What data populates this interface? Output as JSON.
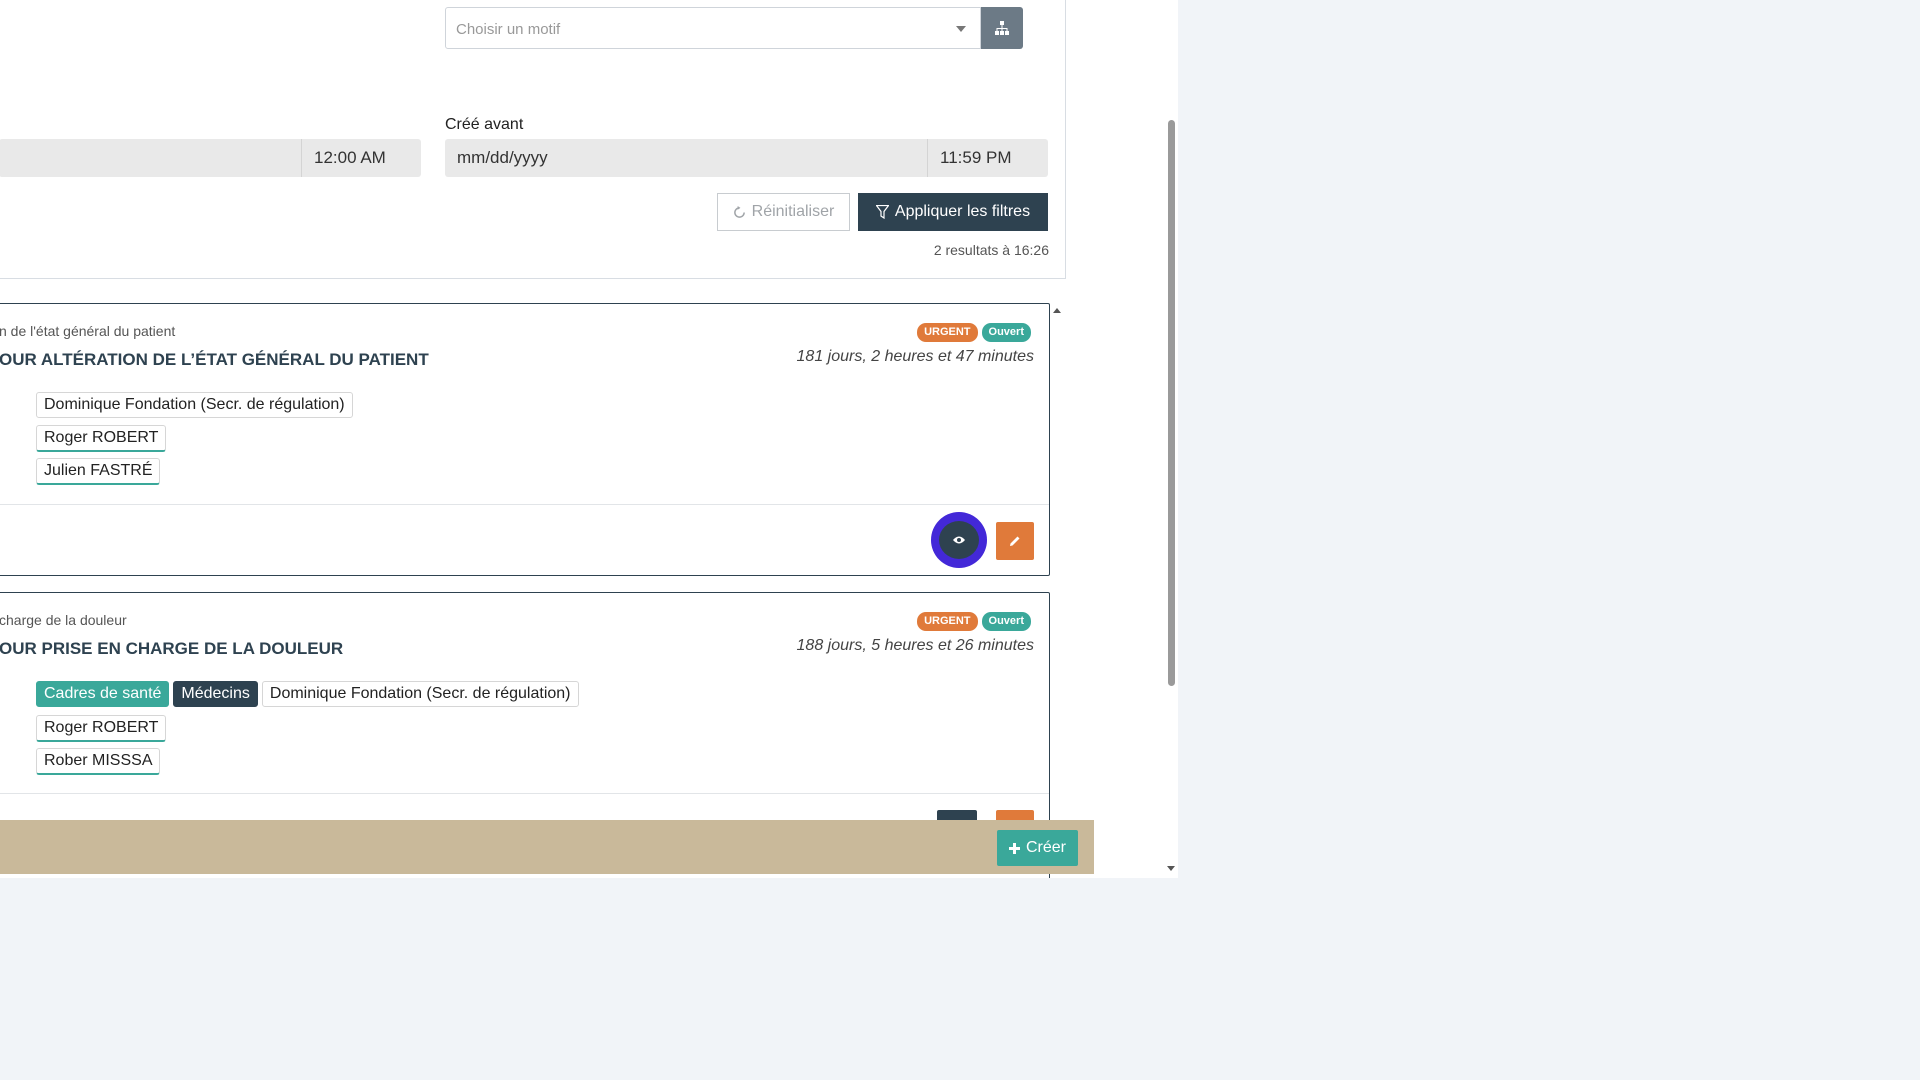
{
  "filters": {
    "motif_placeholder": "Choisir un motif",
    "created_after_time": "12:00 AM",
    "created_before_label": "Créé avant",
    "created_before_date_placeholder": "mm/dd/yyyy",
    "created_before_time": "11:59 PM",
    "reset_label": "Réinitialiser",
    "apply_label": "Appliquer les filtres",
    "results_text": "2 resultats à 16:26"
  },
  "cards": [
    {
      "subtitle": "n de l'état général du patient",
      "title": "OUR ALTÉRATION DE L’ÉTAT GÉNÉRAL DU PATIENT",
      "badge_urgent": "URGENT",
      "badge_status": "Ouvert",
      "duration": "181 jours, 2 heures et 47 minutes",
      "assignees": [
        "Dominique Fondation (Secr. de régulation)"
      ],
      "people": [
        "Roger ROBERT",
        "Julien FASTRÉ"
      ]
    },
    {
      "subtitle": "charge de la douleur",
      "title": "OUR PRISE EN CHARGE DE LA DOULEUR",
      "badge_urgent": "URGENT",
      "badge_status": "Ouvert",
      "duration": "188 jours, 5 heures et 26 minutes",
      "groups": [
        "Cadres de santé",
        "Médecins"
      ],
      "assignees": [
        "Dominique Fondation (Secr. de régulation)"
      ],
      "people": [
        "Roger ROBERT",
        "Rober MISSSA"
      ]
    }
  ],
  "bottom_bar": {
    "create_label": "Créer"
  },
  "colors": {
    "navy": "#2e4250",
    "orange": "#e07a3a",
    "teal": "#3aa89a",
    "focus": "#4328d8",
    "bottom_bar": "#c9b99a"
  },
  "icons": {
    "hierarchy": "sitemap-icon",
    "reset": "refresh-icon",
    "apply": "filter-icon",
    "view": "eye-icon",
    "edit": "pencil-icon",
    "create": "plus-icon"
  }
}
